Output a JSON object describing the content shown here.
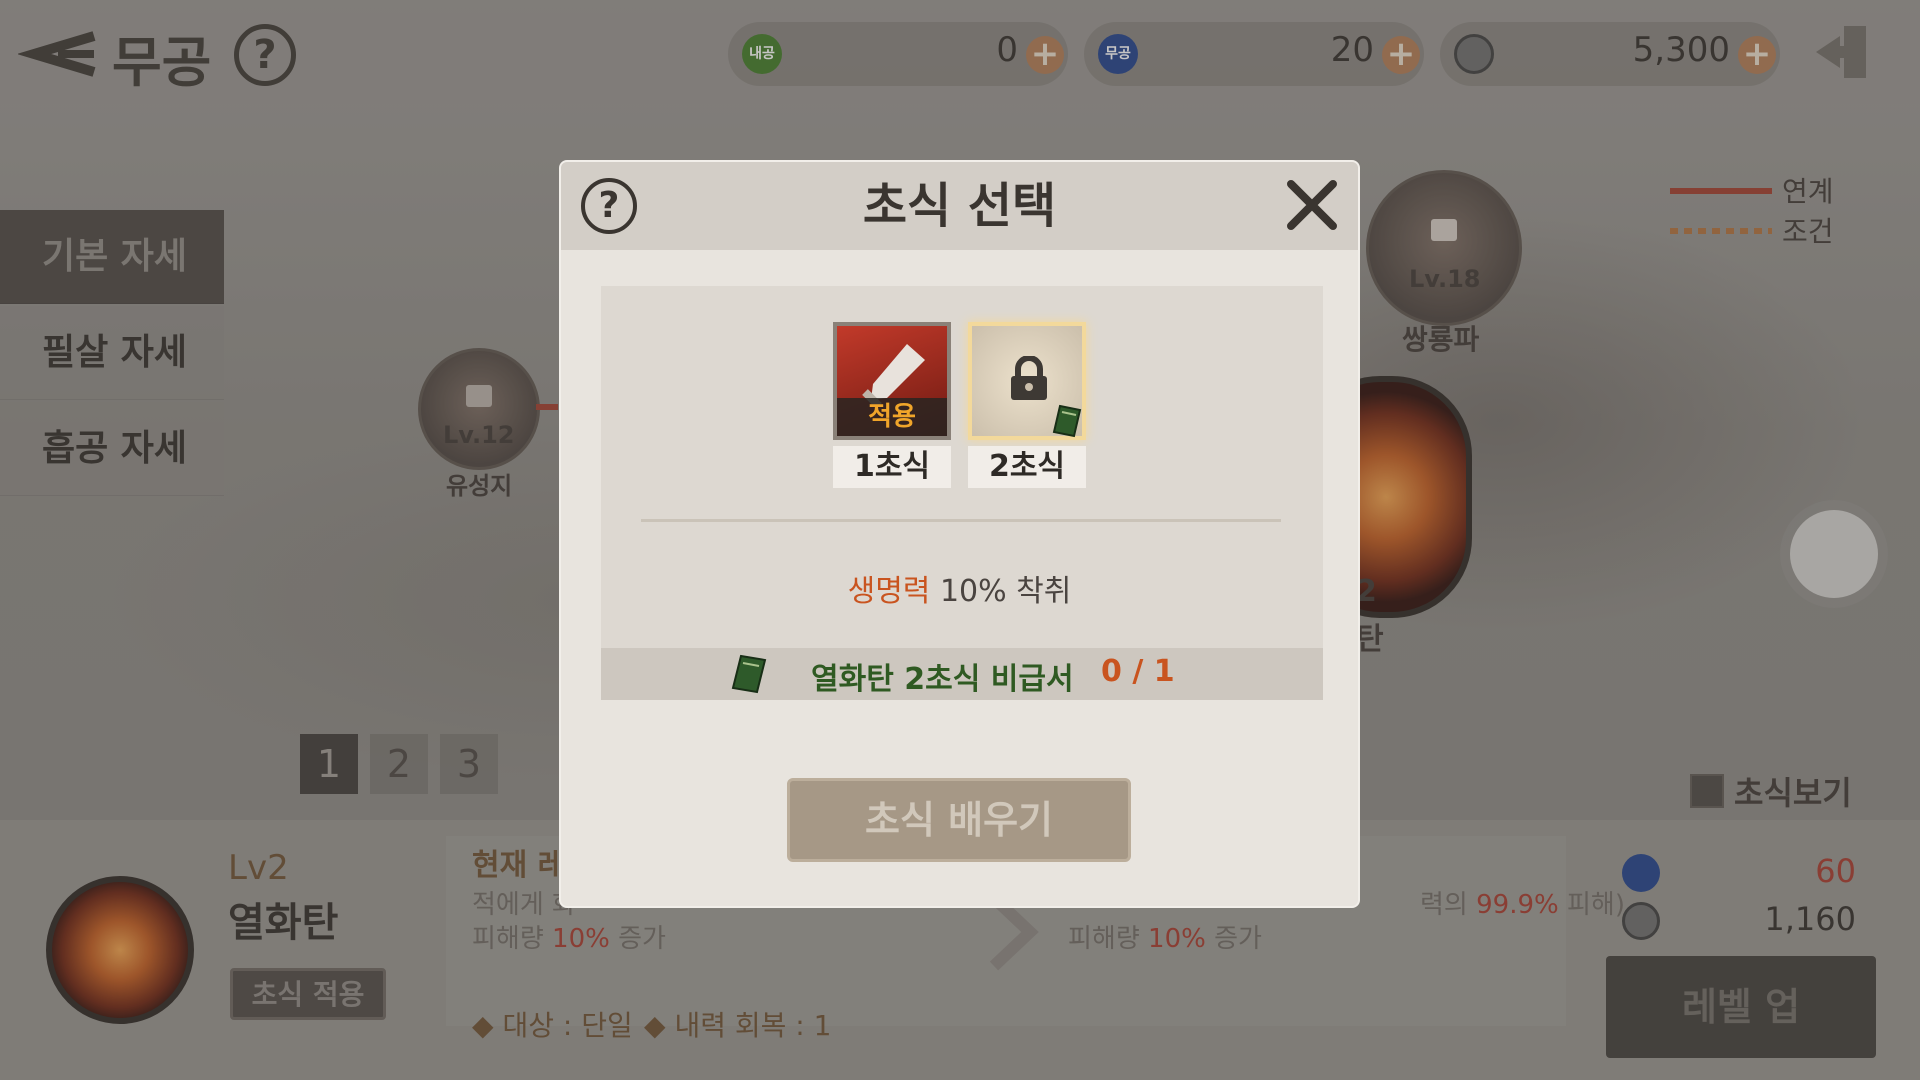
{
  "header": {
    "title": "무공",
    "currencies": [
      {
        "icon": "inner-energy-coin-icon",
        "icon_text": "내공",
        "value": "0",
        "color": "#3f7a24"
      },
      {
        "icon": "martial-coin-icon",
        "icon_text": "무공",
        "value": "20",
        "color": "#1e3f8a"
      },
      {
        "icon": "silver-coin-icon",
        "icon_text": "",
        "value": "5,300",
        "color": "#6a6a6a"
      }
    ]
  },
  "sidebar": {
    "items": [
      {
        "label": "기본 자세",
        "active": true
      },
      {
        "label": "필살 자세",
        "active": false
      },
      {
        "label": "흡공 자세",
        "active": false
      }
    ]
  },
  "nodes": {
    "left": {
      "level": "Lv.12",
      "name": "유성지"
    },
    "right": {
      "level": "Lv.18",
      "name": "쌍룡파"
    },
    "partial": {
      "level": "2",
      "name": "탄"
    }
  },
  "legend": {
    "link": "연계",
    "condition": "조건"
  },
  "pages": [
    "1",
    "2",
    "3"
  ],
  "show_forms": "초식보기",
  "skill_panel": {
    "level": "Lv2",
    "name": "열화탄",
    "apply_button": "초식 적용",
    "current_label": "현재 레",
    "desc_left_1": "적에게 화",
    "desc_left_2_prefix": "피해량 ",
    "desc_left_2_value": "10%",
    "desc_left_2_suffix": " 증가",
    "desc_right_1_prefix": "력의 ",
    "desc_right_1_value": "99.9%",
    "desc_right_1_suffix": " 피해)",
    "desc_right_2_prefix": "피해량 ",
    "desc_right_2_value": "10%",
    "desc_right_2_suffix": " 증가",
    "target": "대상 : 단일",
    "recovery": "내력 회복 : 1",
    "cost_martial": "60",
    "cost_silver": "1,160",
    "levelup_button": "레벨 업"
  },
  "modal": {
    "title": "초식 선택",
    "slots": [
      {
        "label": "1초식",
        "badge": "적용",
        "state": "applied"
      },
      {
        "label": "2초식",
        "badge": "",
        "state": "locked"
      }
    ],
    "effect_highlight": "생명력",
    "effect_rest": "10% 착취",
    "book_name": "열화탄 2초식 비급서",
    "book_count": "0 / 1",
    "learn_button": "초식 배우기"
  }
}
